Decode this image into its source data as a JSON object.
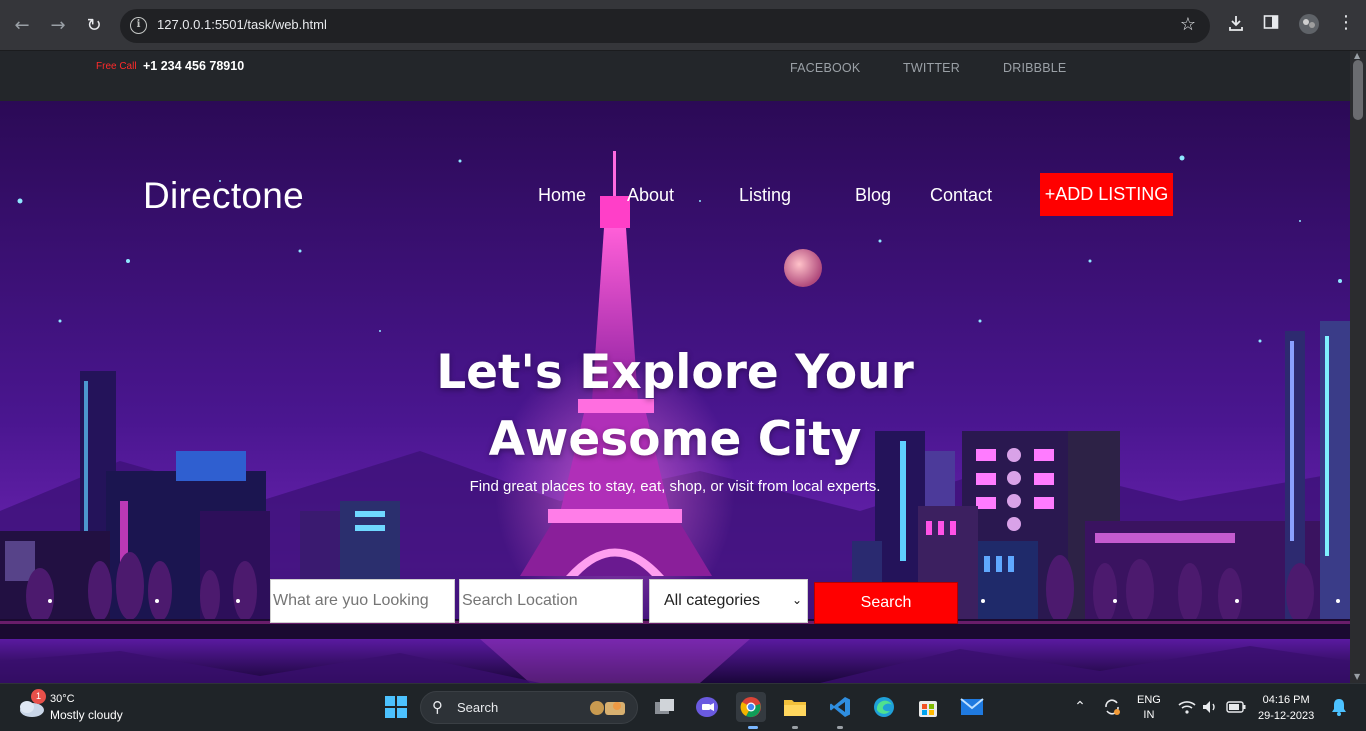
{
  "browser": {
    "url": "127.0.0.1:5501/task/web.html"
  },
  "topbar": {
    "free_call_label": "Free Call",
    "phone": "+1 234 456 78910",
    "social": [
      "FACEBOOK",
      "TWITTER",
      "DRIBBBLE"
    ]
  },
  "header": {
    "brand": "Directone",
    "menu": [
      "Home",
      "About",
      "Listing",
      "Blog",
      "Contact"
    ],
    "add_listing": "+ADD LISTING"
  },
  "hero": {
    "title_line1": "Let's Explore Your",
    "title_line2": "Awesome City",
    "subtitle": "Find great places to stay, eat, shop, or visit from local experts."
  },
  "search_form": {
    "what_placeholder": "What are yuo Looking",
    "location_placeholder": "Search Location",
    "category_selected": "All categories",
    "search_button": "Search"
  },
  "taskbar": {
    "weather_badge": "1",
    "temperature": "30°C",
    "condition": "Mostly cloudy",
    "search_label": "Search",
    "lang_line1": "ENG",
    "lang_line2": "IN",
    "time": "04:16 PM",
    "date": "29-12-2023"
  },
  "colors": {
    "accent_red": "#ff0000",
    "hero_purple": "#2a0b53",
    "topbar_bg": "#23262a"
  }
}
